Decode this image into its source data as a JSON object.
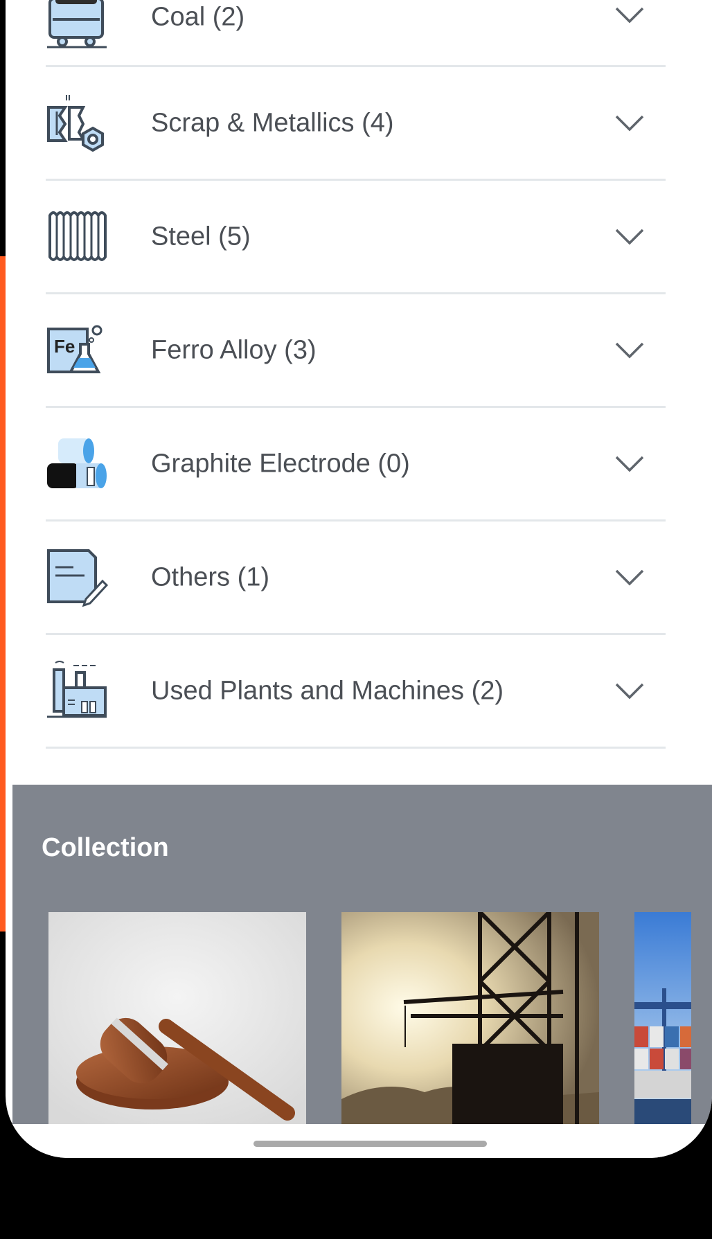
{
  "categories": [
    {
      "label": "Coal (2)",
      "icon": "coal-cart-icon"
    },
    {
      "label": "Scrap & Metallics (4)",
      "icon": "scrap-metallics-icon"
    },
    {
      "label": "Steel (5)",
      "icon": "steel-sheet-icon"
    },
    {
      "label": "Ferro Alloy (3)",
      "icon": "ferro-alloy-flask-icon",
      "icon_text": "Fe"
    },
    {
      "label": "Graphite Electrode (0)",
      "icon": "graphite-electrode-icon"
    },
    {
      "label": "Others (1)",
      "icon": "document-pencil-icon"
    },
    {
      "label": "Used Plants and Machines (2)",
      "icon": "factory-icon"
    }
  ],
  "collection": {
    "title": "Collection",
    "cards": [
      {
        "image": "auction-gavel-image"
      },
      {
        "image": "industrial-crane-image"
      },
      {
        "image": "shipping-containers-image"
      }
    ]
  },
  "colors": {
    "accent_orange": "#ff5a1f",
    "collection_bg": "#80858e",
    "icon_blue": "#bfdcf5",
    "icon_stroke": "#3f4c5a",
    "text": "#4b4f55"
  }
}
